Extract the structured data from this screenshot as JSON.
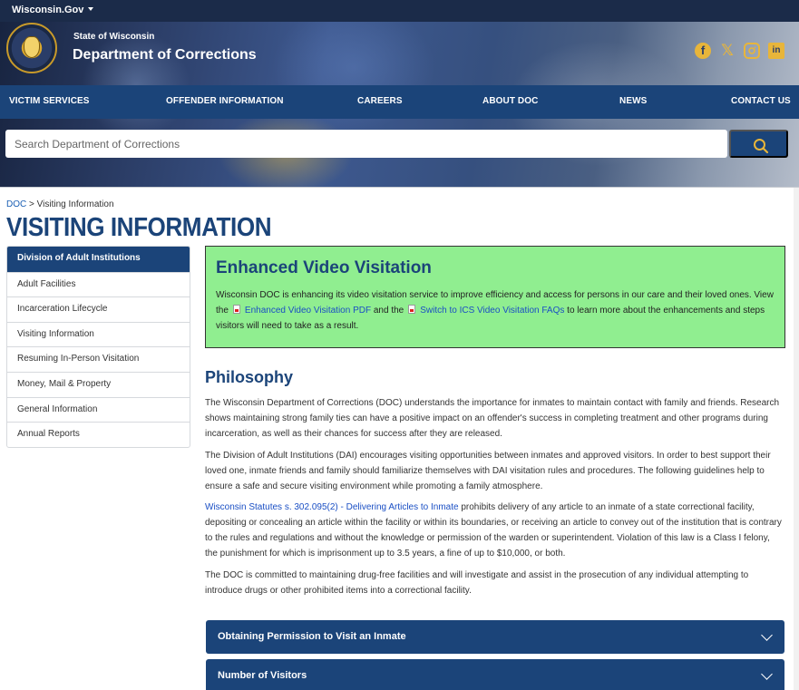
{
  "topbar": {
    "brand": "Wisconsin.Gov"
  },
  "header": {
    "state": "State of Wisconsin",
    "department": "Department of Corrections",
    "social": [
      {
        "icon": "facebook-icon",
        "glyph": "f"
      },
      {
        "icon": "x-icon",
        "glyph": "𝕏"
      },
      {
        "icon": "instagram-icon",
        "glyph": "◎"
      },
      {
        "icon": "linkedin-icon",
        "glyph": "in"
      }
    ]
  },
  "nav": {
    "items": [
      "VICTIM SERVICES",
      "OFFENDER INFORMATION",
      "CAREERS",
      "ABOUT DOC",
      "NEWS",
      "CONTACT US"
    ]
  },
  "search": {
    "placeholder": "Search Department of Corrections"
  },
  "breadcrumb": {
    "home": "DOC",
    "separator": " > ",
    "current": "Visiting Information"
  },
  "page_title": "VISITING INFORMATION",
  "sidebar": {
    "items": [
      {
        "label": "Division of Adult Institutions"
      },
      {
        "label": "Adult Facilities"
      },
      {
        "label": "Incarceration Lifecycle"
      },
      {
        "label": "Visiting Information"
      },
      {
        "label": "Resuming In-Person Visitation"
      },
      {
        "label": "Money, Mail & Property"
      },
      {
        "label": "General Information"
      },
      {
        "label": "Annual Reports"
      }
    ]
  },
  "callout": {
    "title": "Enhanced Video Visitation",
    "text1": "Wisconsin DOC is enhancing its video visitation service to improve efficiency and access for persons in our care and their loved ones. View the",
    "link1": "Enhanced Video Visitation PDF",
    "text2": " and the",
    "link2": "Switch to ICS Video Visitation FAQs",
    "text3": " to learn more about the enhancements and steps visitors will need to take as a result."
  },
  "philosophy": {
    "title": "Philosophy",
    "p1": "The Wisconsin Department of Corrections (DOC) understands the importance for inmates to maintain contact with family and friends. Research shows maintaining strong family ties can have a positive impact on an offender's success in completing treatment and other programs during incarceration, as well as their chances for success after they are released.",
    "p2": "The Division of Adult Institutions (DAI) encourages visiting opportunities between inmates and approved visitors. In order to best support their loved one, inmate friends and family should familiarize themselves with DAI visitation rules and procedures. The following guidelines help to ensure a safe and secure visiting environment while promoting a family atmosphere.",
    "p3_link": "Wisconsin Statutes s. 302.095(2) - Delivering Articles to Inmate",
    "p3_text": " prohibits delivery of any article to an inmate of a state correctional facility, depositing or concealing an article within the facility or within its boundaries, or receiving an article to convey out of the institution that is contrary to the rules and regulations and without the knowledge or permission of the warden or superintendent. Violation of this law is a Class I felony, the punishment for which is imprisonment up to 3.5 years, a fine of up to $10,000, or both.",
    "p4": "The DOC is committed to maintaining drug-free facilities and will investigate and assist in the prosecution of any individual attempting to introduce drugs or other prohibited items into a correctional facility."
  },
  "accordions": [
    {
      "label": "Obtaining Permission to Visit an Inmate"
    },
    {
      "label": "Number of Visitors"
    }
  ],
  "colors": {
    "navy": "#1b4479",
    "topbar": "#1b2b49",
    "callout_bg": "#90ee90",
    "gold": "#e8b53a"
  }
}
